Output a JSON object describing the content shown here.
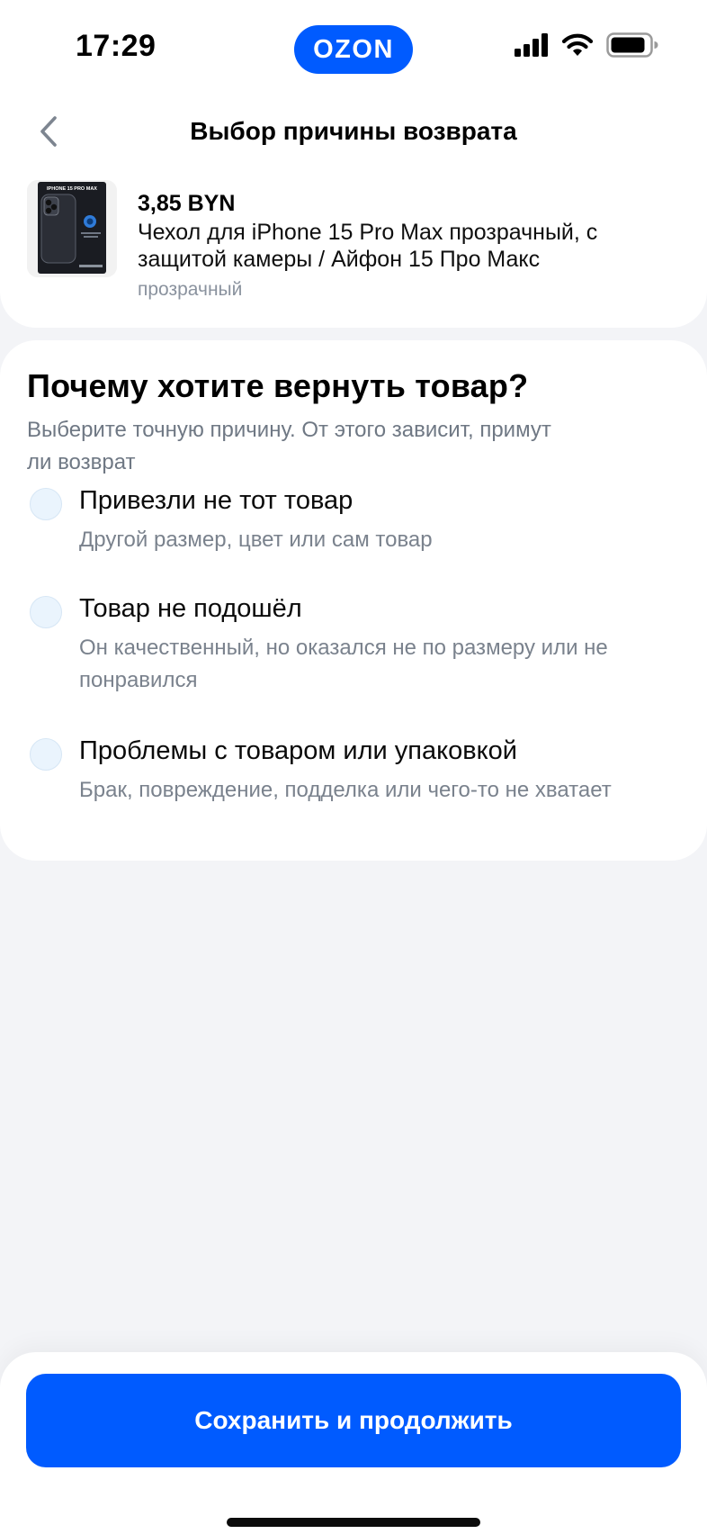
{
  "status_bar": {
    "time": "17:29",
    "brand": "OZON",
    "icons": [
      "signal-icon",
      "wifi-icon",
      "battery-icon"
    ]
  },
  "header": {
    "title": "Выбор причины возврата",
    "back_icon": "chevron-left-icon"
  },
  "product": {
    "price": "3,85 BYN",
    "name": "Чехол для iPhone 15 Pro Max прозрачный, с защитой камеры / Айфон 15 Про Макс",
    "variant": "прозрачный",
    "thumbnail_text": "IPHONE 15 PRO MAX"
  },
  "reasons": {
    "title": "Почему хотите вернуть товар?",
    "subtitle": "Выберите точную причину. От этого зависит, примут ли возврат",
    "options": [
      {
        "label": "Привезли не тот товар",
        "description": "Другой размер, цвет или сам товар",
        "selected": false
      },
      {
        "label": "Товар не подошёл",
        "description": "Он качественный, но оказался не по размеру или не понравился",
        "selected": false
      },
      {
        "label": "Проблемы с товаром или упаковкой",
        "description": "Брак, повреждение, подделка или чего-то не хватает",
        "selected": false
      }
    ]
  },
  "footer": {
    "primary_button": "Сохранить и продолжить"
  },
  "colors": {
    "brand_blue": "#005bff",
    "background": "#f3f4f7",
    "muted_text": "#7a828d",
    "radio_fill": "#eaf4fd"
  }
}
